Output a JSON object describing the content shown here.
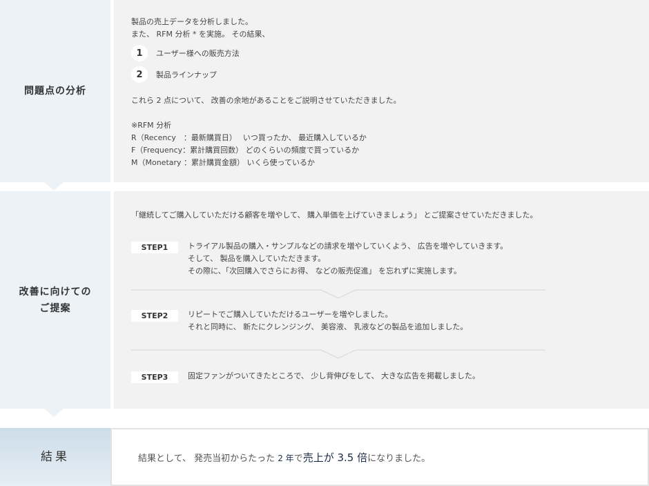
{
  "analysis": {
    "label": "問題点の分析",
    "intro_1": "製品の売上データを分析しました。",
    "intro_2": "また、 RFM 分析 * を実施。 その結果、",
    "points": [
      {
        "num": "1",
        "text": "ユーザー様への販売方法"
      },
      {
        "num": "2",
        "text": "製品ラインナップ"
      }
    ],
    "summary": "これら 2 点について、 改善の余地があることをご説明させていただきました。",
    "rfm_title": "※RFM 分析",
    "rfm_lines": [
      "R（Recency　：最新購買日）　 いつ買ったか、 最近購入しているか",
      "F（Frequency：累計購買回数） どのくらいの頻度で買っているか",
      "M（Monetary ：累計購買金額） いくら使っているか"
    ]
  },
  "proposal": {
    "label_1": "改善に向けての",
    "label_2": "ご提案",
    "quote": "「継続してご購入していただける顧客を増やして、 購入単価を上げていきましょう」 とご提案させていただきました。",
    "steps": [
      {
        "tag": "STEP1",
        "lines": [
          "トライアル製品の購入・サンプルなどの請求を増やしていくよう、 広告を増やしていきます。",
          "そして、 製品を購入していただきます。",
          "その際に、「次回購入でさらにお得、 などの販売促進」 を忘れずに実施します。"
        ]
      },
      {
        "tag": "STEP2",
        "lines": [
          "リピートでご購入していただけるユーザーを増やしました。",
          "それと同時に、 新たにクレンジング、 美容液、 乳液などの製品を追加しました。"
        ]
      },
      {
        "tag": "STEP3",
        "lines": [
          "固定ファンがついてきたところで、 少し背伸びをして、 大きな広告を掲載しました。"
        ]
      }
    ]
  },
  "result": {
    "label": "結果",
    "pre": "結果として、 発売当初からたった ",
    "years": "2 年",
    "mid": "で",
    "highlight": "売上が 3.5 倍",
    "post": "になりました。"
  },
  "colors": {
    "label_bg": "#edf2f6",
    "content_bg": "#f2f2f2",
    "accent_text": "#1c2b4a"
  }
}
